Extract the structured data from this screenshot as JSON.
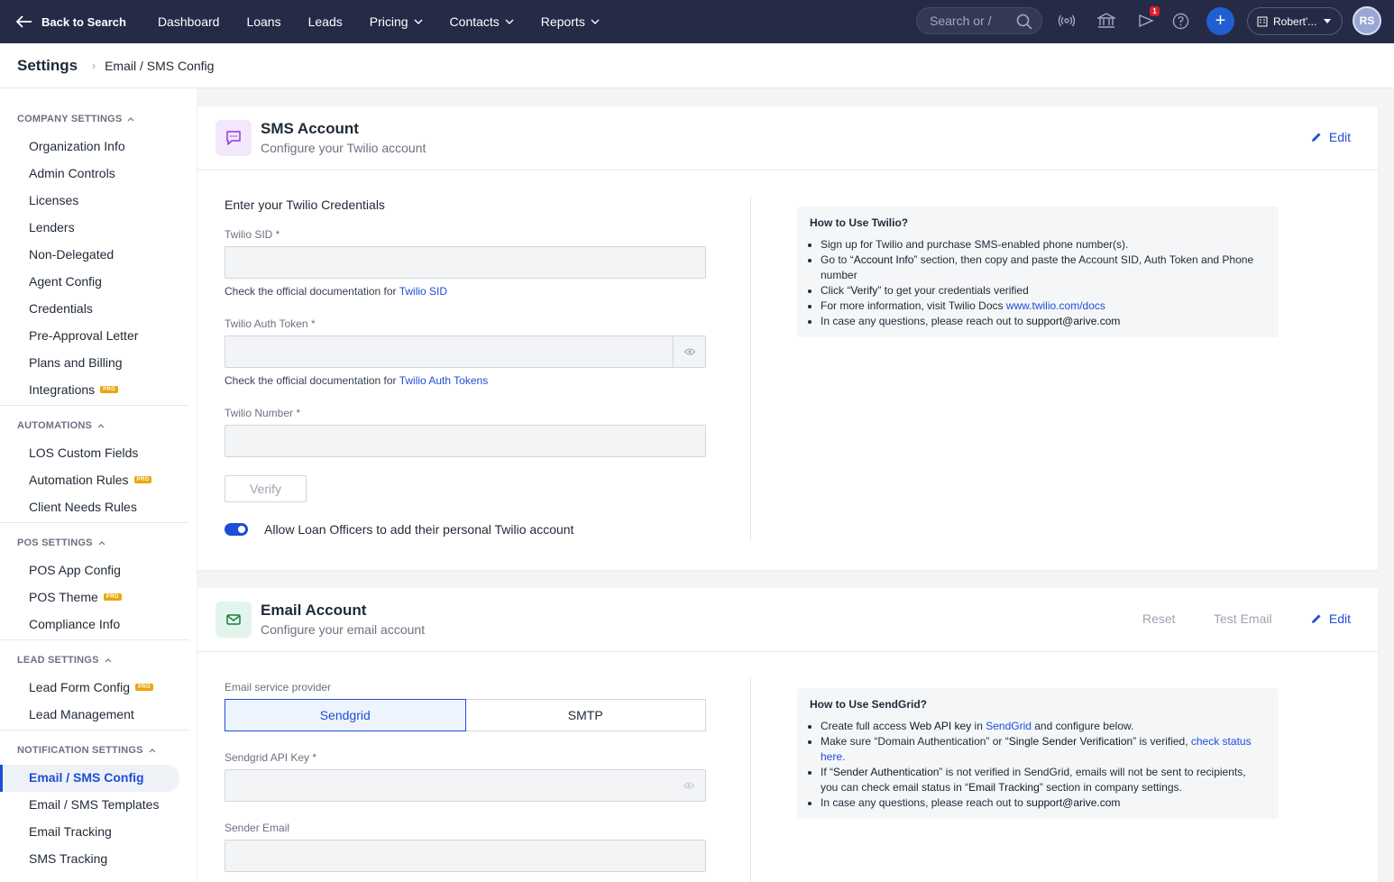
{
  "topbar": {
    "back_label": "Back to Search",
    "nav": [
      {
        "label": "Dashboard",
        "dropdown": false
      },
      {
        "label": "Loans",
        "dropdown": false
      },
      {
        "label": "Leads",
        "dropdown": false
      },
      {
        "label": "Pricing",
        "dropdown": true
      },
      {
        "label": "Contacts",
        "dropdown": true
      },
      {
        "label": "Reports",
        "dropdown": true
      }
    ],
    "search_placeholder": "Search or /",
    "notification_count": "1",
    "company_label": "Robert'...",
    "avatar_initials": "RS",
    "icons": [
      "search-icon",
      "broadcast-icon",
      "bank-icon",
      "megaphone-icon",
      "help-icon",
      "plus-icon",
      "building-icon"
    ]
  },
  "breadcrumb": {
    "title": "Settings",
    "current": "Email / SMS Config"
  },
  "sidebar": {
    "sections": [
      {
        "title": "COMPANY SETTINGS",
        "items": [
          {
            "label": "Organization Info",
            "pro": false
          },
          {
            "label": "Admin Controls",
            "pro": false
          },
          {
            "label": "Licenses",
            "pro": false
          },
          {
            "label": "Lenders",
            "pro": false
          },
          {
            "label": "Non-Delegated",
            "pro": false
          },
          {
            "label": "Agent Config",
            "pro": false
          },
          {
            "label": "Credentials",
            "pro": false
          },
          {
            "label": "Pre-Approval Letter",
            "pro": false
          },
          {
            "label": "Plans and Billing",
            "pro": false
          },
          {
            "label": "Integrations",
            "pro": true
          }
        ]
      },
      {
        "title": "AUTOMATIONS",
        "items": [
          {
            "label": "LOS Custom Fields",
            "pro": false
          },
          {
            "label": "Automation Rules",
            "pro": true
          },
          {
            "label": "Client Needs Rules",
            "pro": false
          }
        ]
      },
      {
        "title": "POS SETTINGS",
        "items": [
          {
            "label": "POS App Config",
            "pro": false
          },
          {
            "label": "POS Theme",
            "pro": true
          },
          {
            "label": "Compliance Info",
            "pro": false
          }
        ]
      },
      {
        "title": "LEAD SETTINGS",
        "items": [
          {
            "label": "Lead Form Config",
            "pro": true
          },
          {
            "label": "Lead Management",
            "pro": false
          }
        ]
      },
      {
        "title": "NOTIFICATION SETTINGS",
        "items": [
          {
            "label": "Email / SMS Config",
            "pro": false,
            "active": true
          },
          {
            "label": "Email / SMS Templates",
            "pro": false
          },
          {
            "label": "Email Tracking",
            "pro": false
          },
          {
            "label": "SMS Tracking",
            "pro": false
          }
        ]
      }
    ],
    "pro_label": "PRO"
  },
  "sms": {
    "title": "SMS Account",
    "subtitle": "Configure your Twilio account",
    "edit_label": "Edit",
    "creds_heading": "Enter your Twilio Credentials",
    "sid_label": "Twilio SID *",
    "sid_value": "",
    "sid_help_prefix": "Check the official documentation for",
    "sid_help_link": "Twilio SID",
    "token_label": "Twilio Auth Token *",
    "token_value": "",
    "token_help_prefix": "Check the official documentation for",
    "token_help_link": "Twilio Auth Tokens",
    "number_label": "Twilio Number *",
    "number_value": "",
    "verify_label": "Verify",
    "toggle_label": "Allow Loan Officers to add their personal Twilio account",
    "toggle_on": true,
    "info_title": "How to Use Twilio?",
    "info_items": [
      [
        {
          "t": "Sign up for Twilio and purchase SMS-enabled phone number(s)."
        }
      ],
      [
        {
          "t": "Go to “"
        },
        {
          "t": "Account Info",
          "b": true
        },
        {
          "t": "” section, then copy and paste the Account SID, Auth Token and Phone number"
        }
      ],
      [
        {
          "t": "Click “"
        },
        {
          "t": "Verify",
          "b": true
        },
        {
          "t": "” to get your credentials verified"
        }
      ],
      [
        {
          "t": "For more information, visit Twilio Docs "
        },
        {
          "t": "www.twilio.com/docs",
          "link": true
        }
      ],
      [
        {
          "t": "In case any questions, please reach out to "
        },
        {
          "t": "support@arive.com",
          "b": true
        }
      ]
    ]
  },
  "email": {
    "title": "Email Account",
    "subtitle": "Configure your email account",
    "reset_label": "Reset",
    "test_label": "Test Email",
    "edit_label": "Edit",
    "provider_label": "Email service provider",
    "providers": [
      "Sendgrid",
      "SMTP"
    ],
    "selected_provider": "Sendgrid",
    "api_key_label": "Sendgrid API Key *",
    "api_key_value": "",
    "sender_label": "Sender Email",
    "sender_value": "",
    "info_title": "How to Use SendGrid?",
    "info_items": [
      [
        {
          "t": "Create full access "
        },
        {
          "t": "Web API key",
          "b": true
        },
        {
          "t": " in "
        },
        {
          "t": "SendGrid",
          "link": true
        },
        {
          "t": " and configure below."
        }
      ],
      [
        {
          "t": "Make sure “Domain Authentication” or “"
        },
        {
          "t": "Single Sender Verification",
          "b": true
        },
        {
          "t": "” is verified, "
        },
        {
          "t": "check status here.",
          "link": true
        }
      ],
      [
        {
          "t": "If “"
        },
        {
          "t": "Sender Authentication",
          "b": true
        },
        {
          "t": "” is not verified in SendGrid, emails will not be sent to recipients, you can check email status in “"
        },
        {
          "t": "Email Tracking",
          "b": true
        },
        {
          "t": "” section in company settings."
        }
      ],
      [
        {
          "t": "In case any questions, please reach out to "
        },
        {
          "t": "support@arive.com",
          "b": true
        }
      ]
    ]
  },
  "colors": {
    "topbar": "#252a46",
    "accent": "#1d4ed8",
    "pro_badge": "#e8a80c",
    "sms_icon_bg": "#f3e8fb",
    "email_icon_bg": "#e3f4ec"
  }
}
